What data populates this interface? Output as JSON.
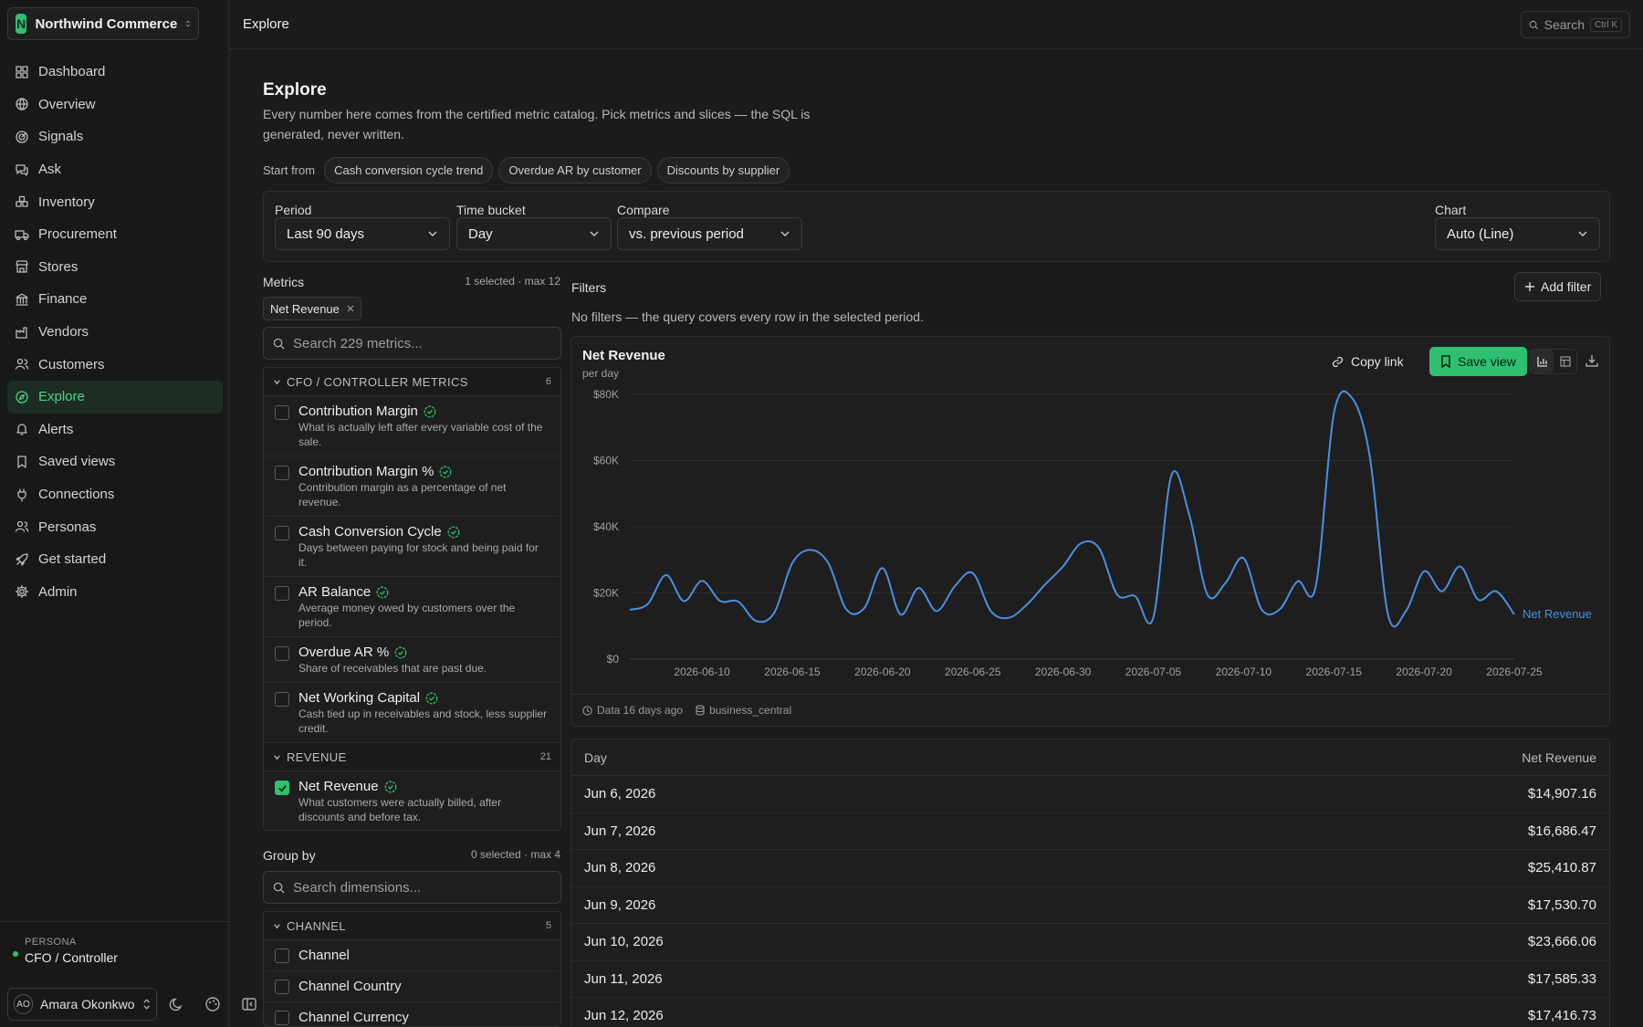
{
  "app": {
    "org_name": "Northwind Commerce",
    "org_initial": "N"
  },
  "colors": {
    "accent": "#2fbf71",
    "series": "#4a90e2",
    "background": "#1b1b1b"
  },
  "sidebar": {
    "items": [
      {
        "label": "Dashboard",
        "icon": "dashboard-icon"
      },
      {
        "label": "Overview",
        "icon": "globe-icon"
      },
      {
        "label": "Signals",
        "icon": "radar-icon"
      },
      {
        "label": "Ask",
        "icon": "chat-icon"
      },
      {
        "label": "Inventory",
        "icon": "boxes-icon"
      },
      {
        "label": "Procurement",
        "icon": "truck-icon"
      },
      {
        "label": "Stores",
        "icon": "store-icon"
      },
      {
        "label": "Finance",
        "icon": "bank-icon"
      },
      {
        "label": "Vendors",
        "icon": "factory-icon"
      },
      {
        "label": "Customers",
        "icon": "users-icon"
      },
      {
        "label": "Explore",
        "icon": "compass-icon",
        "active": true
      },
      {
        "label": "Alerts",
        "icon": "bell-icon"
      },
      {
        "label": "Saved views",
        "icon": "bookmark-icon"
      },
      {
        "label": "Connections",
        "icon": "plug-icon"
      },
      {
        "label": "Personas",
        "icon": "people-icon"
      },
      {
        "label": "Get started",
        "icon": "rocket-icon"
      },
      {
        "label": "Admin",
        "icon": "gear-icon"
      }
    ],
    "persona_label": "PERSONA",
    "persona_value": "CFO / Controller",
    "user_initials": "AO",
    "user_name": "Amara Okonkwo"
  },
  "topbar": {
    "breadcrumb": "Explore",
    "search_label": "Search",
    "search_shortcut": "Ctrl K"
  },
  "header": {
    "title": "Explore",
    "description": "Every number here comes from the certified metric catalog. Pick metrics and slices — the SQL is generated, never written.",
    "start_from_label": "Start from",
    "starters": [
      "Cash conversion cycle trend",
      "Overdue AR by customer",
      "Discounts by supplier"
    ]
  },
  "controls": {
    "period": {
      "label": "Period",
      "value": "Last 90 days"
    },
    "bucket": {
      "label": "Time bucket",
      "value": "Day"
    },
    "compare": {
      "label": "Compare",
      "value": "vs. previous period"
    },
    "chart": {
      "label": "Chart",
      "value": "Auto (Line)"
    }
  },
  "metrics": {
    "label": "Metrics",
    "selected_info": "1 selected · max 12",
    "selected_tag": "Net Revenue",
    "search_placeholder": "Search 229 metrics...",
    "groups": [
      {
        "name": "CFO / CONTROLLER METRICS",
        "count": "6",
        "items": [
          {
            "name": "Contribution Margin",
            "desc": "What is actually left after every variable cost of the sale."
          },
          {
            "name": "Contribution Margin %",
            "desc": "Contribution margin as a percentage of net revenue."
          },
          {
            "name": "Cash Conversion Cycle",
            "desc": "Days between paying for stock and being paid for it."
          },
          {
            "name": "AR Balance",
            "desc": "Average money owed by customers over the period."
          },
          {
            "name": "Overdue AR %",
            "desc": "Share of receivables that are past due."
          },
          {
            "name": "Net Working Capital",
            "desc": "Cash tied up in receivables and stock, less supplier credit."
          }
        ]
      },
      {
        "name": "REVENUE",
        "count": "21",
        "items": [
          {
            "name": "Net Revenue",
            "desc": "What customers were actually billed, after discounts and before tax.",
            "checked": true
          }
        ]
      }
    ]
  },
  "group_by": {
    "label": "Group by",
    "selected_info": "0 selected · max 4",
    "search_placeholder": "Search dimensions...",
    "group": {
      "name": "CHANNEL",
      "count": "5",
      "items": [
        "Channel",
        "Channel Country",
        "Channel Currency"
      ]
    }
  },
  "filters": {
    "label": "Filters",
    "add_label": "Add filter",
    "empty_text": "No filters — the query covers every row in the selected period."
  },
  "chart_card": {
    "title": "Net Revenue",
    "subtitle": "per day",
    "copy_link_label": "Copy link",
    "save_view_label": "Save view",
    "freshness": "Data 16 days ago",
    "source": "business_central"
  },
  "chart_data": {
    "type": "line",
    "title": "Net Revenue",
    "subtitle": "per day",
    "x_ticks": [
      "2026-06-10",
      "2026-06-15",
      "2026-06-20",
      "2026-06-25",
      "2026-06-30",
      "2026-07-05",
      "2026-07-10",
      "2026-07-15",
      "2026-07-20",
      "2026-07-25"
    ],
    "y_ticks": [
      "$0",
      "$20K",
      "$40K",
      "$60K",
      "$80K"
    ],
    "ylim": [
      0,
      80000
    ],
    "xlim": [
      "2026-06-06",
      "2026-07-25"
    ],
    "grid": true,
    "series": [
      {
        "name": "Net Revenue",
        "x": [
          "2026-06-06",
          "2026-06-07",
          "2026-06-08",
          "2026-06-09",
          "2026-06-10",
          "2026-06-11",
          "2026-06-12",
          "2026-06-13",
          "2026-06-14",
          "2026-06-15",
          "2026-06-16",
          "2026-06-17",
          "2026-06-18",
          "2026-06-19",
          "2026-06-20",
          "2026-06-21",
          "2026-06-22",
          "2026-06-23",
          "2026-06-24",
          "2026-06-25",
          "2026-06-26",
          "2026-06-27",
          "2026-06-28",
          "2026-06-29",
          "2026-06-30",
          "2026-07-01",
          "2026-07-02",
          "2026-07-03",
          "2026-07-04",
          "2026-07-05",
          "2026-07-06",
          "2026-07-07",
          "2026-07-08",
          "2026-07-09",
          "2026-07-10",
          "2026-07-11",
          "2026-07-12",
          "2026-07-13",
          "2026-07-14",
          "2026-07-15",
          "2026-07-16",
          "2026-07-17",
          "2026-07-18",
          "2026-07-19",
          "2026-07-20",
          "2026-07-21",
          "2026-07-22",
          "2026-07-23",
          "2026-07-24",
          "2026-07-25"
        ],
        "values": [
          14907.16,
          16686.47,
          25410.87,
          17530.7,
          23666.06,
          17585.33,
          17416.73,
          11500,
          14000,
          29000,
          33000,
          29000,
          15000,
          15500,
          27500,
          13500,
          21500,
          14500,
          22000,
          26000,
          14500,
          12500,
          16500,
          22500,
          28000,
          35000,
          33500,
          19500,
          19000,
          12500,
          55500,
          43500,
          19500,
          23000,
          30500,
          15000,
          15000,
          23500,
          22000,
          74000,
          79000,
          61000,
          13500,
          14500,
          26500,
          20500,
          28000,
          18000,
          20500,
          13500
        ]
      }
    ]
  },
  "table": {
    "headers": [
      "Day",
      "Net Revenue"
    ],
    "rows": [
      [
        "Jun 6, 2026",
        "$14,907.16"
      ],
      [
        "Jun 7, 2026",
        "$16,686.47"
      ],
      [
        "Jun 8, 2026",
        "$25,410.87"
      ],
      [
        "Jun 9, 2026",
        "$17,530.70"
      ],
      [
        "Jun 10, 2026",
        "$23,666.06"
      ],
      [
        "Jun 11, 2026",
        "$17,585.33"
      ],
      [
        "Jun 12, 2026",
        "$17,416.73"
      ]
    ]
  }
}
